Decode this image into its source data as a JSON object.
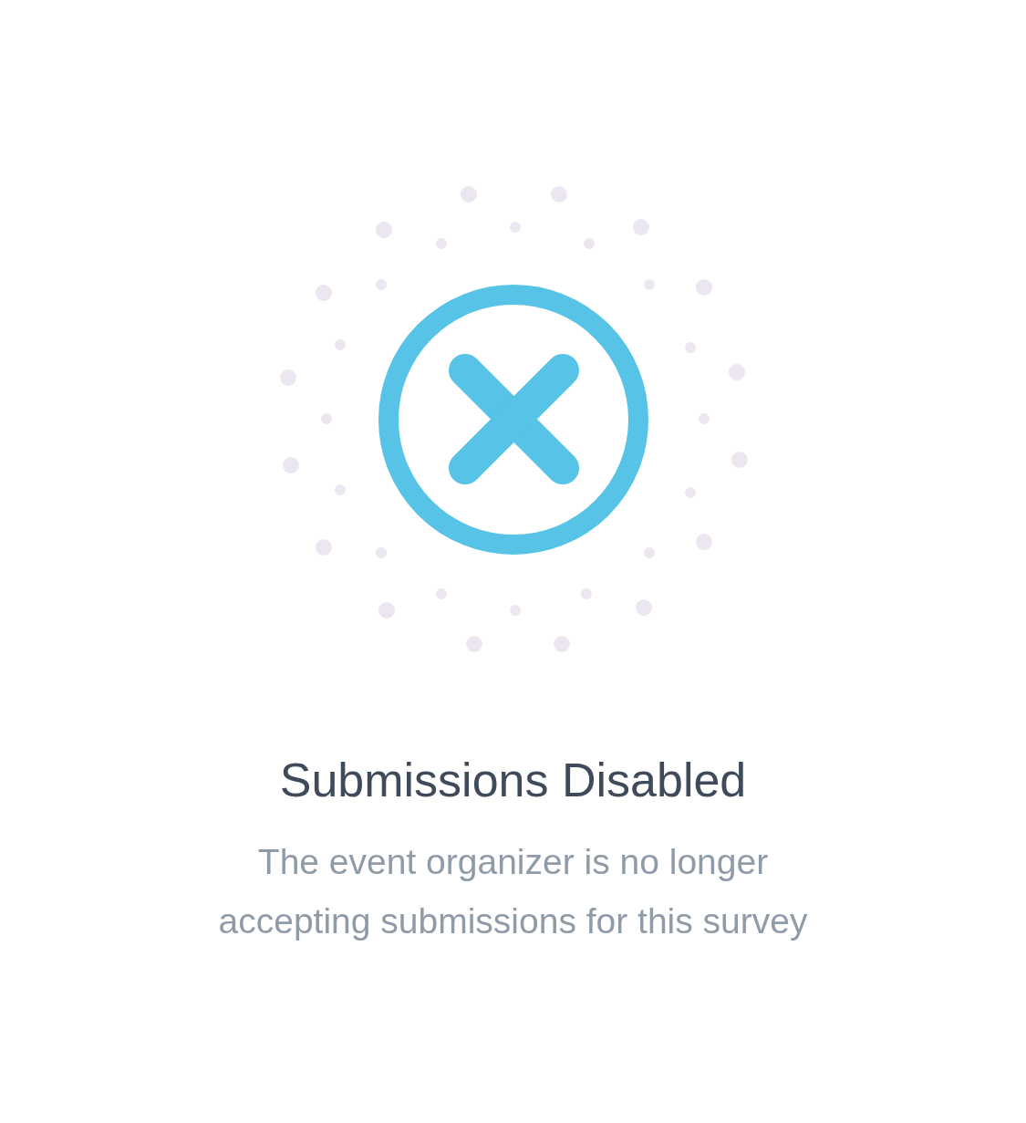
{
  "title": "Submissions Disabled",
  "message": "The event organizer is no longer\naccepting submissions for this survey"
}
